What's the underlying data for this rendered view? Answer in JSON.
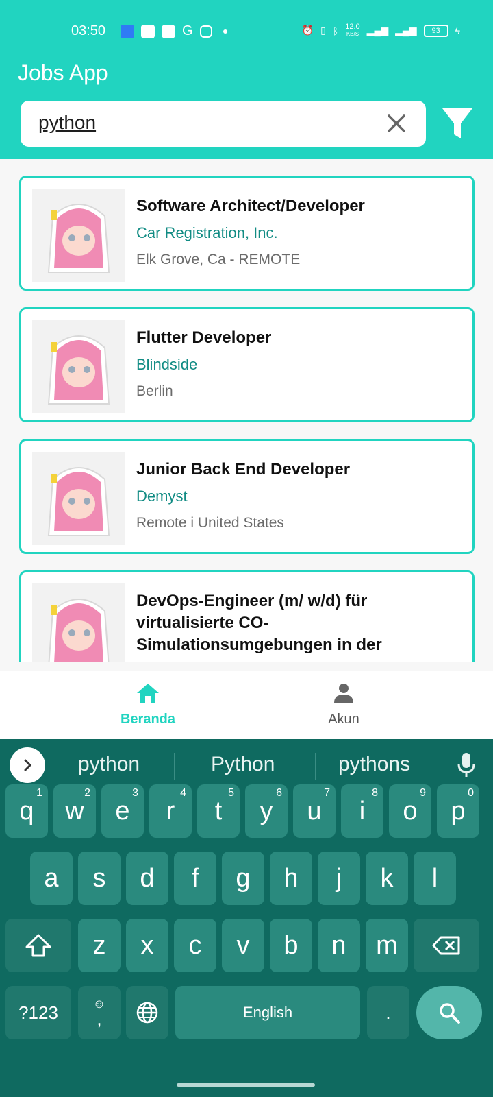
{
  "statusbar": {
    "time": "03:50",
    "net_speed": "12.0",
    "net_unit": "KB/S",
    "battery": "93"
  },
  "app": {
    "title": "Jobs App"
  },
  "search": {
    "value": "python"
  },
  "jobs": [
    {
      "title": "Software Architect/Developer",
      "company": "Car Registration, Inc.",
      "location": "Elk Grove, Ca - REMOTE"
    },
    {
      "title": "Flutter Developer",
      "company": "Blindside",
      "location": "Berlin"
    },
    {
      "title": "Junior Back End Developer",
      "company": "Demyst",
      "location": "Remote i United States"
    },
    {
      "title": "DevOps-Engineer (m/ w/d) für virtualisierte CO-Simulationsumgebungen in der",
      "company": "",
      "location": ""
    }
  ],
  "nav": {
    "home": "Beranda",
    "account": "Akun"
  },
  "keyboard": {
    "suggestions": [
      "python",
      "Python",
      "pythons"
    ],
    "row1": [
      "q",
      "w",
      "e",
      "r",
      "t",
      "y",
      "u",
      "i",
      "o",
      "p"
    ],
    "row1_nums": [
      "1",
      "2",
      "3",
      "4",
      "5",
      "6",
      "7",
      "8",
      "9",
      "0"
    ],
    "row2": [
      "a",
      "s",
      "d",
      "f",
      "g",
      "h",
      "j",
      "k",
      "l"
    ],
    "row3": [
      "z",
      "x",
      "c",
      "v",
      "b",
      "n",
      "m"
    ],
    "symbols": "?123",
    "comma": ",",
    "space": "English",
    "period": "."
  },
  "colors": {
    "accent": "#21d4c0",
    "company": "#128c84",
    "keyboard_bg": "#0f6a60"
  }
}
